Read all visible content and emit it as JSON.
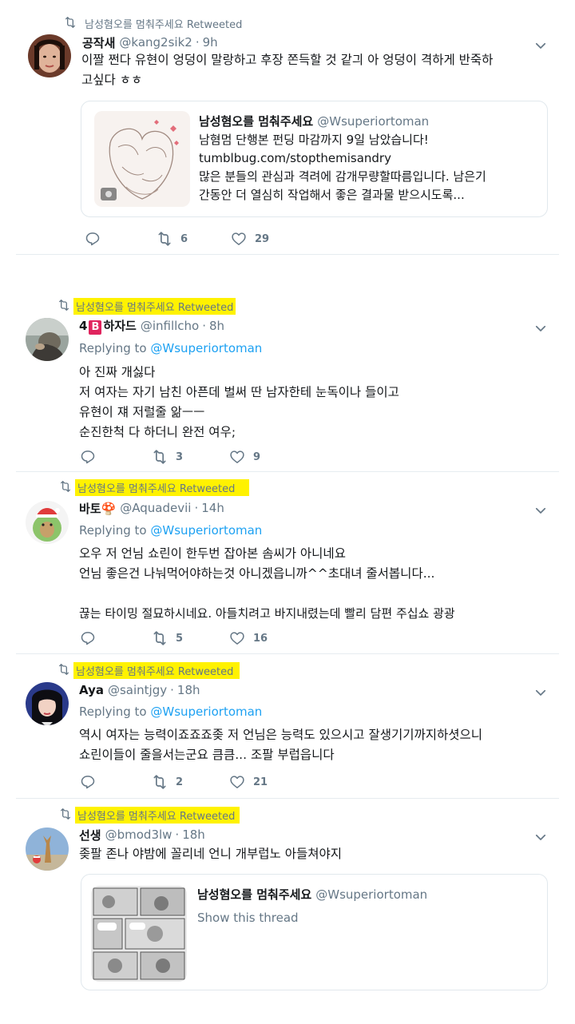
{
  "retweeted_label": "남성혐오를 멈춰주세요 Retweeted",
  "replying_prefix": "Replying to",
  "replying_handle": "@Wsuperiortoman",
  "tweets": [
    {
      "name": "공작새",
      "handle": "@kang2sik2",
      "time": "9h",
      "lines": [
        "이짤 쩐다 유현이 엉덩이 말랑하고 후장 쫀득할 것 같긔 아 엉덩이 격하게 반죽하",
        "고싶다 ㅎㅎ"
      ],
      "replies": "",
      "retweets": "6",
      "likes": "29"
    },
    {
      "name_prefix": "4",
      "name_badge": "B",
      "name": "하자드",
      "handle": "@infillcho",
      "time": "8h",
      "lines": [
        "아 진짜 개싫다",
        "저 여자는 자기 남친 아픈데 벌써 딴 남자한테 눈독이나 들이고",
        "유현이 쟤 저럴줄 앎ㅡㅡ",
        "순진한척 다 하더니 완전 여우;"
      ],
      "retweets": "3",
      "likes": "9"
    },
    {
      "name": "바토🍄",
      "handle": "@Aquadevii",
      "time": "14h",
      "lines": [
        "오우 저 언님 쇼린이 한두번 잡아본 솜씨가 아니네요",
        "언님 좋은건 나눠먹어야하는것 아니겠읍니까^^초대녀 줄서봅니다...",
        "",
        "끊는 타이밍 절묘하시네요. 아들치려고 바지내렸는데 빨리 담편 주십쇼 광광"
      ],
      "retweets": "5",
      "likes": "16"
    },
    {
      "name": "Aya",
      "handle": "@saintjgy",
      "time": "18h",
      "lines": [
        "역시 여자는 능력이죠죠죠좆 저 언님은 능력도 있으시고 잘생기기까지하셧으니",
        "쇼린이들이 줄을서는군요 큼큼... 조팔 부럽읍니다"
      ],
      "retweets": "2",
      "likes": "21"
    },
    {
      "name": "선생",
      "handle": "@bmod3lw",
      "time": "18h",
      "lines": [
        "좆팔 존나 야밤에 꼴리네 언니 개부럽노 아들쳐야지"
      ]
    }
  ],
  "card1": {
    "name": "남성혐오를 멈춰주세요",
    "handle": "@Wsuperiortoman",
    "lines": [
      "남혐멈 단행본 펀딩 마감까지 9일 남았습니다!",
      "tumblbug.com/stopthemisandry",
      "많은 분들의 관심과 격려에 감개무량할따름입니다. 남은기",
      "간동안 더 열심히 작업해서 좋은 결과물 받으시도록..."
    ]
  },
  "card2": {
    "name": "남성혐오를 멈춰주세요",
    "handle": "@Wsuperiortoman",
    "show_thread": "Show this thread"
  },
  "colors": {
    "accent": "#1da1f2",
    "muted": "#657786",
    "highlight": "#fff200",
    "badge": "#e0245e"
  }
}
